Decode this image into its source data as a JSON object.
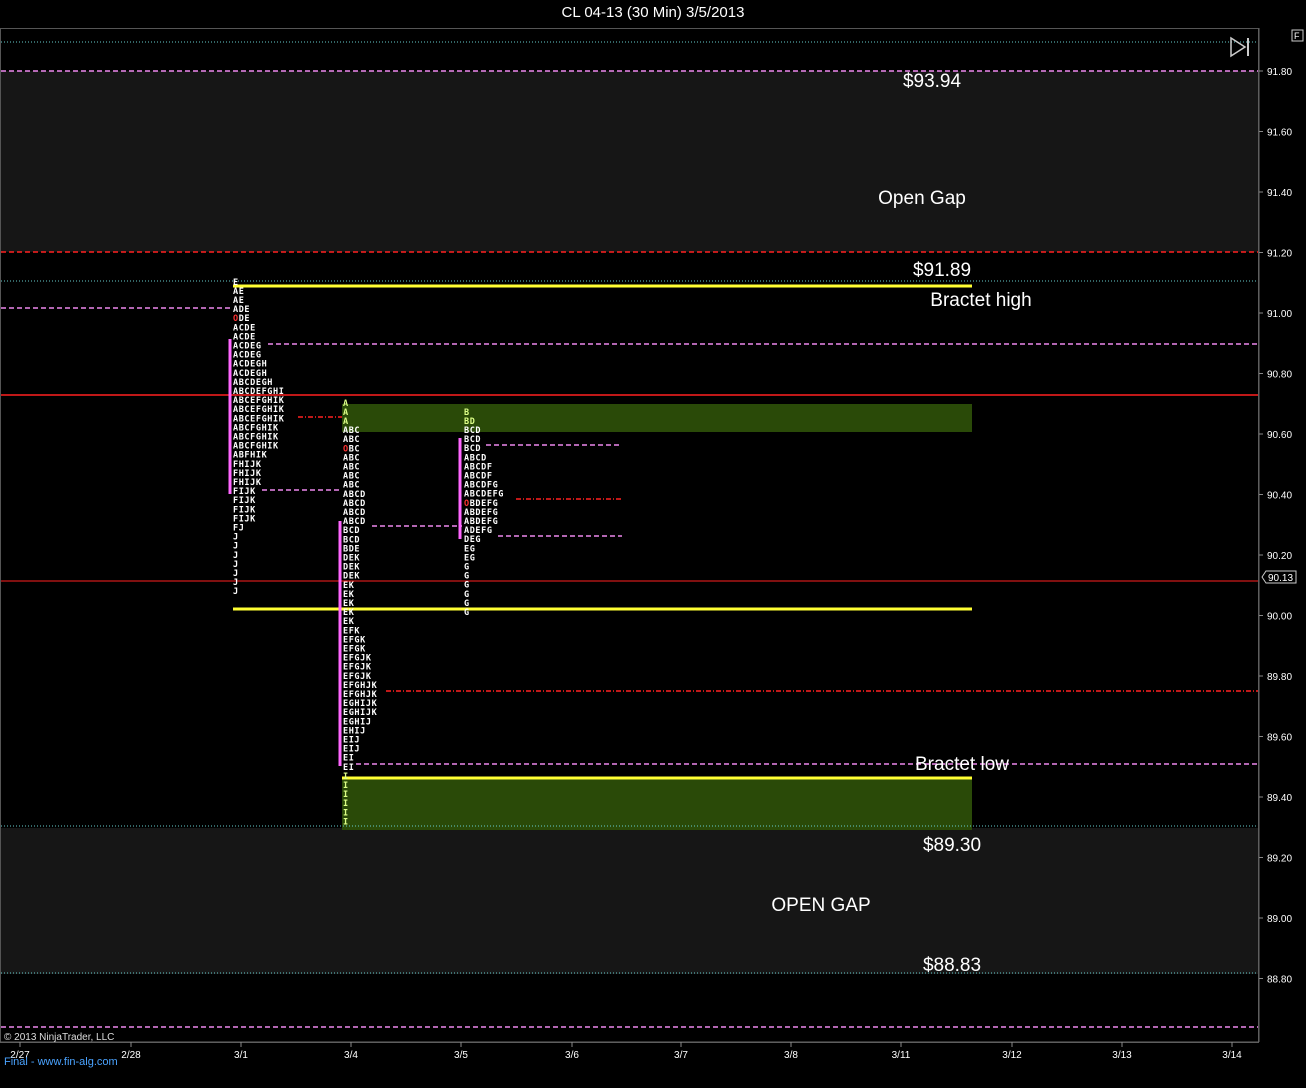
{
  "window": {
    "title": "CL 04-13 (30 Min)  3/5/2013"
  },
  "toolbar": {
    "f_button": "F"
  },
  "copyright": "© 2013 NinjaTrader, LLC",
  "watermark": "Final - www.fin-alg.com",
  "colors": {
    "background": "#000000",
    "gap_band": "#161616",
    "value_area": "#2a4a08",
    "yellow_line": "#ffff33",
    "red_line": "#ff2020",
    "magenta_dash": "#ee88ee",
    "cyan_dot": "#66cccc",
    "poc_bar": "#ff66ff"
  },
  "y_axis": {
    "ticks": [
      "91.80",
      "91.60",
      "91.40",
      "91.20",
      "91.00",
      "90.80",
      "90.60",
      "90.40",
      "90.20",
      "90.00",
      "89.80",
      "89.60",
      "89.40",
      "89.20",
      "89.00",
      "88.80"
    ],
    "current_price": "90.13"
  },
  "x_axis": {
    "ticks": [
      "2/27",
      "2/28",
      "3/1",
      "3/4",
      "3/5",
      "3/6",
      "3/7",
      "3/8",
      "3/11",
      "3/12",
      "3/13",
      "3/14"
    ]
  },
  "annotations": {
    "gap_top_price": "$93.94",
    "open_gap_upper": "Open Gap",
    "bracket_high_price": "$91.89",
    "bracket_high_label": "Bractet high",
    "bracket_low_label": "Bractet low",
    "gap_lower_price_1": "$89.30",
    "open_gap_lower": "OPEN GAP",
    "gap_lower_price_2": "$88.83"
  },
  "chart_data": {
    "type": "market_profile",
    "title": "CL 04-13 (30 Min)  3/5/2013",
    "y_range": [
      88.64,
      91.95
    ],
    "tick_size": 0.03,
    "current_price": 90.13,
    "profiles": [
      {
        "date": "3/1",
        "top_price": 91.1,
        "rows": [
          "E",
          "AE",
          "AE",
          "ADE",
          "ODE",
          "ACDE",
          "ACDE",
          "ACDEG",
          "ACDEG",
          "ACDEGH",
          "ACDEGH",
          "ABCDEGH",
          "ABCDEFGHI",
          "ABCEFGHIK",
          "ABCEFGHIK",
          "ABCEFGHIK",
          "ABCFGHIK",
          "ABCFGHIK",
          "ABCFGHIK",
          "ABFHIK",
          "FHIJK",
          "FHIJK",
          "FHIJK",
          "FIJK",
          "FIJK",
          "FIJK",
          "FIJK",
          "FJ",
          "J",
          "J",
          "J",
          "J",
          "J",
          "J",
          "J"
        ]
      },
      {
        "date": "3/4",
        "top_price": 90.7,
        "rows": [
          "A",
          "A",
          "A",
          "ABC",
          "ABC",
          "OBC",
          "ABC",
          "ABC",
          "ABC",
          "ABC",
          "ABCD",
          "ABCD",
          "ABCD",
          "ABCD",
          "BCD",
          "BCD",
          "BDE",
          "DEK",
          "DEK",
          "DEK",
          "EK",
          "EK",
          "EK",
          "EK",
          "EK",
          "EFK",
          "EFGK",
          "EFGK",
          "EFGJK",
          "EFGJK",
          "EFGJK",
          "EFGHJK",
          "EFGHJK",
          "EGHIJK",
          "EGHIJK",
          "EGHIJ",
          "EHIJ",
          "EIJ",
          "EIJ",
          "EI",
          "EI",
          "I",
          "I",
          "I",
          "I",
          "I",
          "I"
        ]
      },
      {
        "date": "3/5",
        "top_price": 90.67,
        "rows": [
          "B",
          "BD",
          "BCD",
          "BCD",
          "BCD",
          "ABCD",
          "ABCDF",
          "ABCDF",
          "ABCDFG",
          "ABCDEFG",
          "OBDEFG",
          "ABDEFG",
          "ABDEFG",
          "ADEFG",
          "DEG",
          "EG",
          "EG",
          "G",
          "G",
          "G",
          "G",
          "G",
          "G"
        ]
      }
    ],
    "levels": [
      {
        "price": 93.94,
        "label": "$93.94"
      },
      {
        "price": 91.89,
        "label": "$91.89"
      },
      {
        "price": 89.3,
        "label": "$89.30"
      },
      {
        "price": 88.83,
        "label": "$88.83"
      }
    ]
  }
}
